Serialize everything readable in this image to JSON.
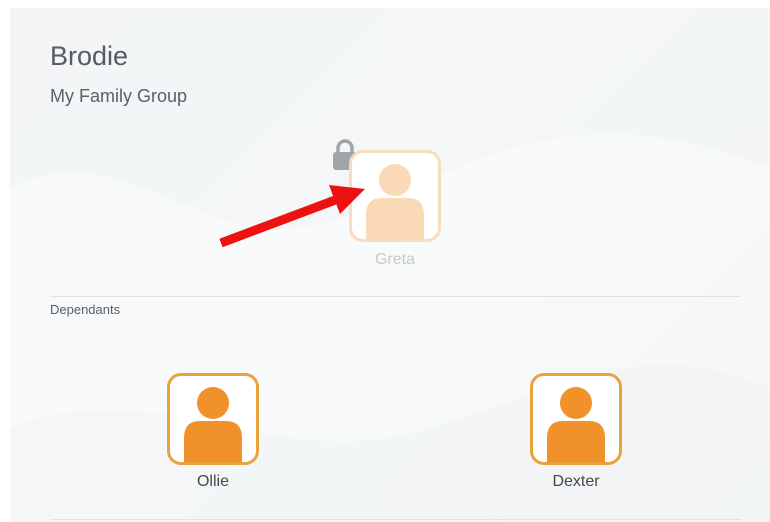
{
  "profile": {
    "name": "Brodie",
    "group_title": "My Family Group"
  },
  "owner": {
    "name": "Greta",
    "icon": "user-icon",
    "locked": true
  },
  "sections": {
    "dependants_label": "Dependants"
  },
  "dependants": [
    {
      "name": "Ollie",
      "icon": "user-icon"
    },
    {
      "name": "Dexter",
      "icon": "user-icon"
    }
  ],
  "colors": {
    "accent": "#f0912a",
    "accent_border": "#e8a33e",
    "faded_fill": "#fad9b6",
    "faded_border": "#f7dcbf",
    "lock": "#a2a5a8",
    "annotation_arrow": "#ee1111"
  }
}
